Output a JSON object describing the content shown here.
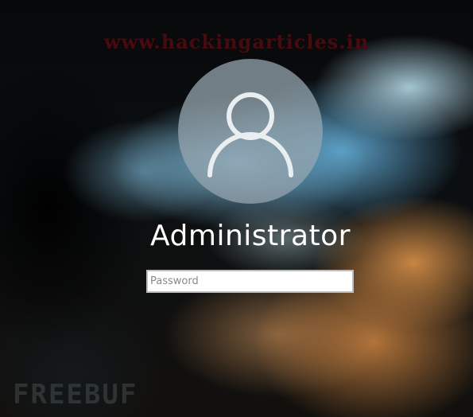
{
  "watermark_top": "www.hackingarticles.in",
  "watermark_bottom": "FREEBUF",
  "user": {
    "name": "Administrator",
    "avatar_icon": "user-icon"
  },
  "password": {
    "placeholder": "Password",
    "value": ""
  },
  "colors": {
    "username_text": "#ffffff",
    "watermark_top": "#4d0b10",
    "input_border": "#bdbdbd"
  }
}
